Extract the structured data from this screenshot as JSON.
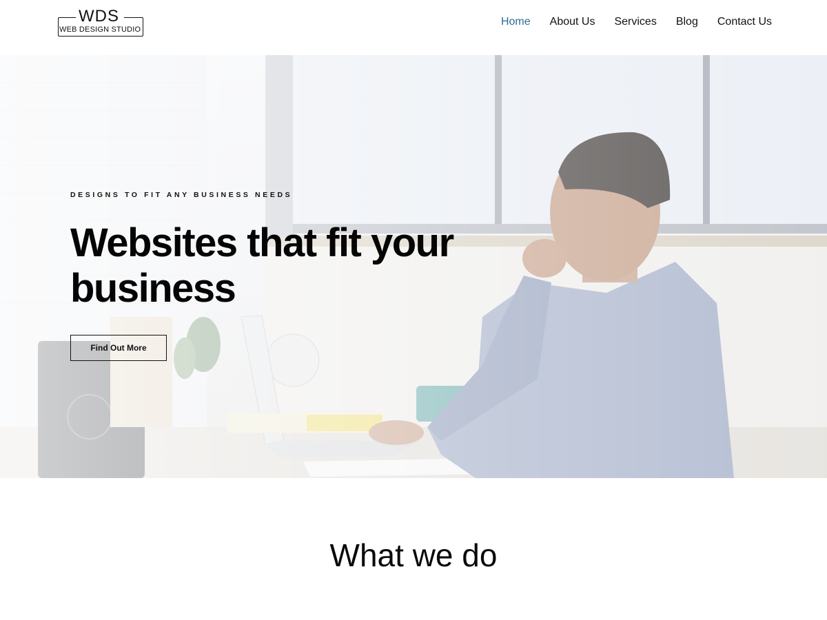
{
  "logo": {
    "top": "WDS",
    "bottom": "WEB DESIGN STUDIO"
  },
  "nav": {
    "items": [
      {
        "label": "Home",
        "active": true
      },
      {
        "label": "About Us",
        "active": false
      },
      {
        "label": "Services",
        "active": false
      },
      {
        "label": "Blog",
        "active": false
      },
      {
        "label": "Contact Us",
        "active": false
      }
    ]
  },
  "hero": {
    "eyebrow": "DESIGNS TO FIT ANY BUSINESS NEEDS",
    "headline_line1": "Websites that fit your",
    "headline_line2": "business",
    "cta_label": "Find Out More"
  },
  "section": {
    "title": "What we do"
  },
  "colors": {
    "nav_active": "#2b6e8f",
    "text": "#111111",
    "background": "#ffffff"
  }
}
